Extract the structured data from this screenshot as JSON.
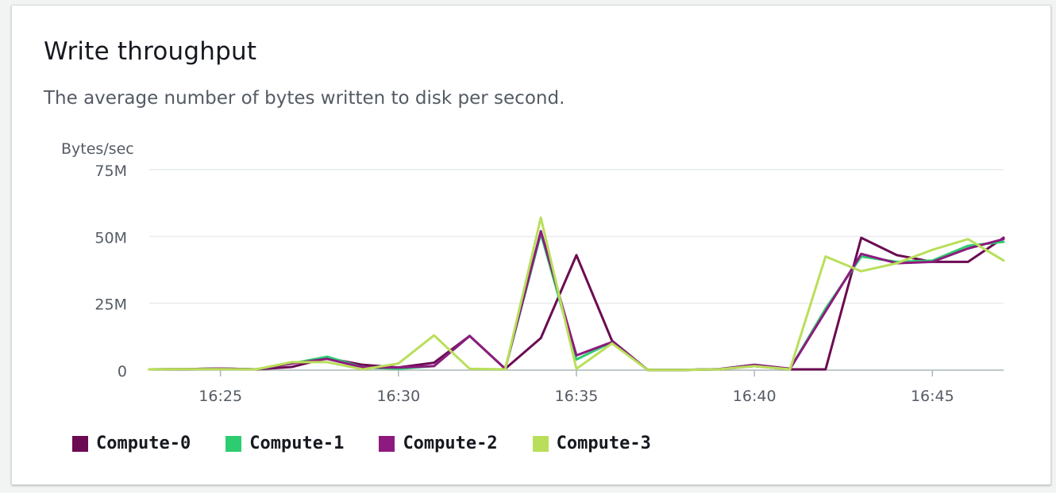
{
  "widget": {
    "title": "Write throughput",
    "subtitle": "The average number of bytes written to disk per second."
  },
  "chart_data": {
    "type": "line",
    "title": "Write throughput",
    "subtitle": "The average number of bytes written to disk per second.",
    "ylabel": "Bytes/sec",
    "xlabel": "",
    "ylim": [
      0,
      75000000
    ],
    "y_ticks": [
      0,
      25000000,
      50000000,
      75000000
    ],
    "y_tick_labels": [
      "0",
      "25M",
      "50M",
      "75M"
    ],
    "xlim": [
      "16:23",
      "16:47"
    ],
    "x_tick_labels": [
      "16:25",
      "16:30",
      "16:35",
      "16:40",
      "16:45"
    ],
    "grid": "horizontal",
    "legend_position": "bottom-left",
    "x": [
      "16:23",
      "16:24",
      "16:25",
      "16:26",
      "16:27",
      "16:28",
      "16:29",
      "16:30",
      "16:31",
      "16:32",
      "16:33",
      "16:34",
      "16:35",
      "16:36",
      "16:37",
      "16:38",
      "16:39",
      "16:40",
      "16:41",
      "16:42",
      "16:43",
      "16:44",
      "16:45",
      "16:46",
      "16:47"
    ],
    "series": [
      {
        "name": "Compute-0",
        "color": "#6b0b52",
        "values": [
          0.3,
          0.4,
          0.6,
          0.3,
          1.2,
          4.5,
          2.0,
          1.0,
          2.8,
          12.8,
          0.5,
          12.0,
          43.0,
          11.0,
          0.1,
          0.1,
          0.3,
          1.5,
          0.3,
          0.3,
          49.5,
          43.0,
          40.5,
          40.5,
          49.5
        ]
      },
      {
        "name": "Compute-1",
        "color": "#2ecc71",
        "values": [
          0.3,
          0.4,
          0.6,
          0.3,
          2.5,
          5.0,
          1.0,
          0.5,
          1.5,
          12.8,
          0.5,
          51.0,
          4.0,
          10.5,
          0.1,
          0.1,
          0.4,
          2.0,
          0.5,
          23.0,
          42.5,
          40.5,
          41.0,
          46.5,
          48.0
        ]
      },
      {
        "name": "Compute-2",
        "color": "#8e1a7f",
        "values": [
          0.3,
          0.4,
          0.6,
          0.3,
          2.5,
          4.2,
          1.0,
          1.0,
          1.5,
          12.8,
          0.5,
          52.0,
          5.5,
          10.5,
          0.1,
          0.1,
          0.4,
          2.0,
          0.5,
          22.0,
          43.5,
          40.0,
          40.5,
          45.5,
          49.0
        ]
      },
      {
        "name": "Compute-3",
        "color": "#b9df5a",
        "values": [
          0.3,
          0.4,
          0.4,
          0.3,
          3.0,
          3.0,
          0.3,
          2.5,
          13.0,
          0.5,
          0.3,
          57.0,
          0.5,
          10.0,
          0.1,
          0.1,
          0.3,
          1.5,
          0.3,
          42.5,
          37.0,
          40.0,
          45.0,
          49.0,
          41.0
        ]
      }
    ],
    "value_unit_multiplier": 1000000
  },
  "icons": {
    "legend_swatch": "square"
  }
}
